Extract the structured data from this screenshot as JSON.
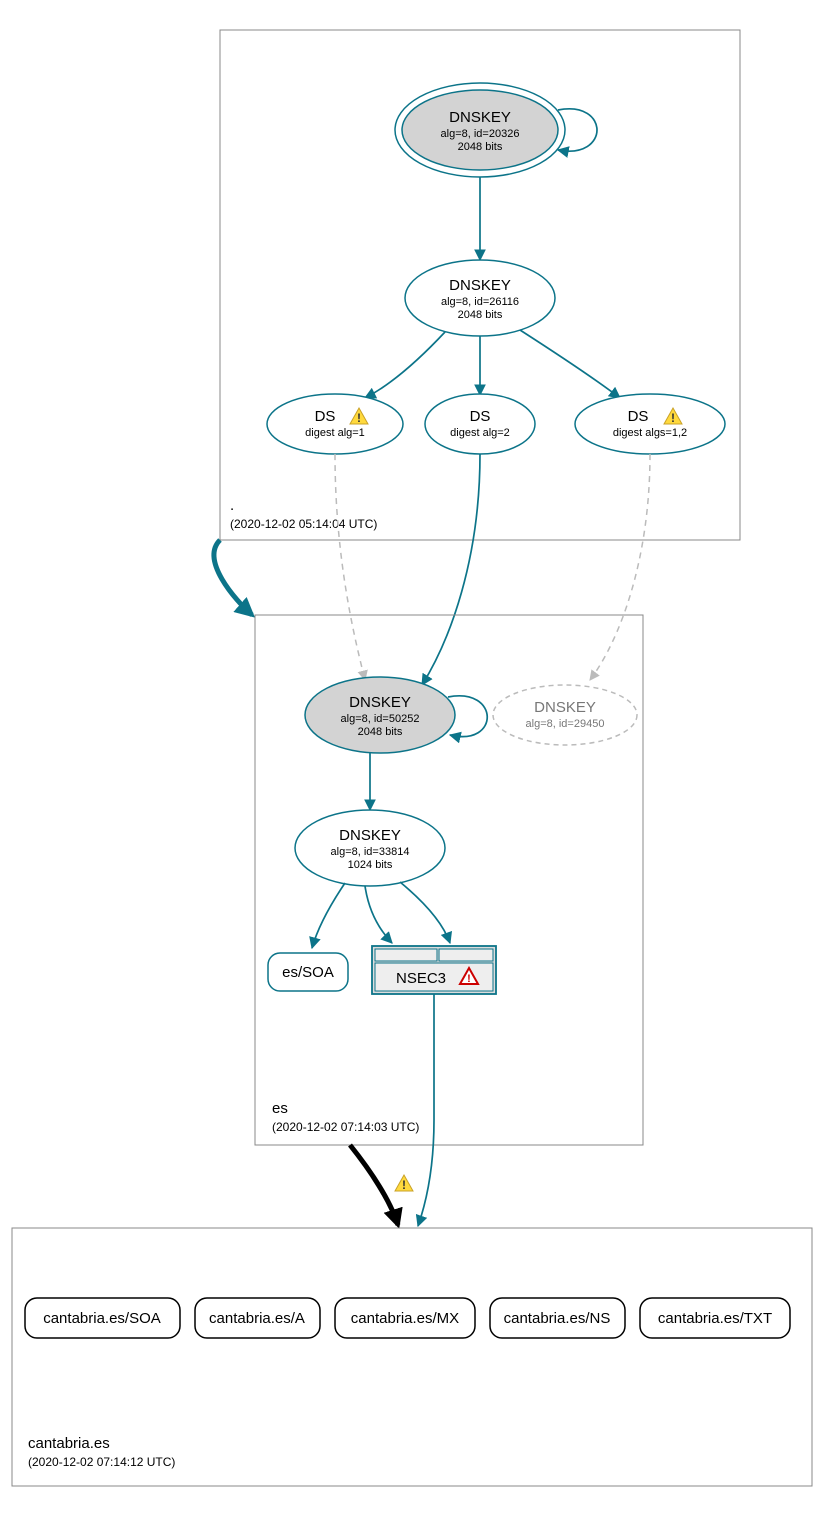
{
  "zones": {
    "root": {
      "name": ".",
      "timestamp": "(2020-12-02 05:14:04 UTC)",
      "nodes": {
        "ksk": {
          "title": "DNSKEY",
          "line1": "alg=8, id=20326",
          "line2": "2048 bits"
        },
        "zsk": {
          "title": "DNSKEY",
          "line1": "alg=8, id=26116",
          "line2": "2048 bits"
        },
        "ds1": {
          "title": "DS",
          "line1": "digest alg=1",
          "warn": true
        },
        "ds2": {
          "title": "DS",
          "line1": "digest alg=2"
        },
        "ds3": {
          "title": "DS",
          "line1": "digest algs=1,2",
          "warn": true
        }
      }
    },
    "es": {
      "name": "es",
      "timestamp": "(2020-12-02 07:14:03 UTC)",
      "nodes": {
        "ksk": {
          "title": "DNSKEY",
          "line1": "alg=8, id=50252",
          "line2": "2048 bits"
        },
        "ghost": {
          "title": "DNSKEY",
          "line1": "alg=8, id=29450"
        },
        "zsk": {
          "title": "DNSKEY",
          "line1": "alg=8, id=33814",
          "line2": "1024 bits"
        },
        "soa": {
          "title": "es/SOA"
        },
        "nsec3": {
          "title": "NSEC3"
        }
      }
    },
    "cantabria": {
      "name": "cantabria.es",
      "timestamp": "(2020-12-02 07:14:12 UTC)",
      "records": [
        "cantabria.es/SOA",
        "cantabria.es/A",
        "cantabria.es/MX",
        "cantabria.es/NS",
        "cantabria.es/TXT"
      ]
    }
  }
}
